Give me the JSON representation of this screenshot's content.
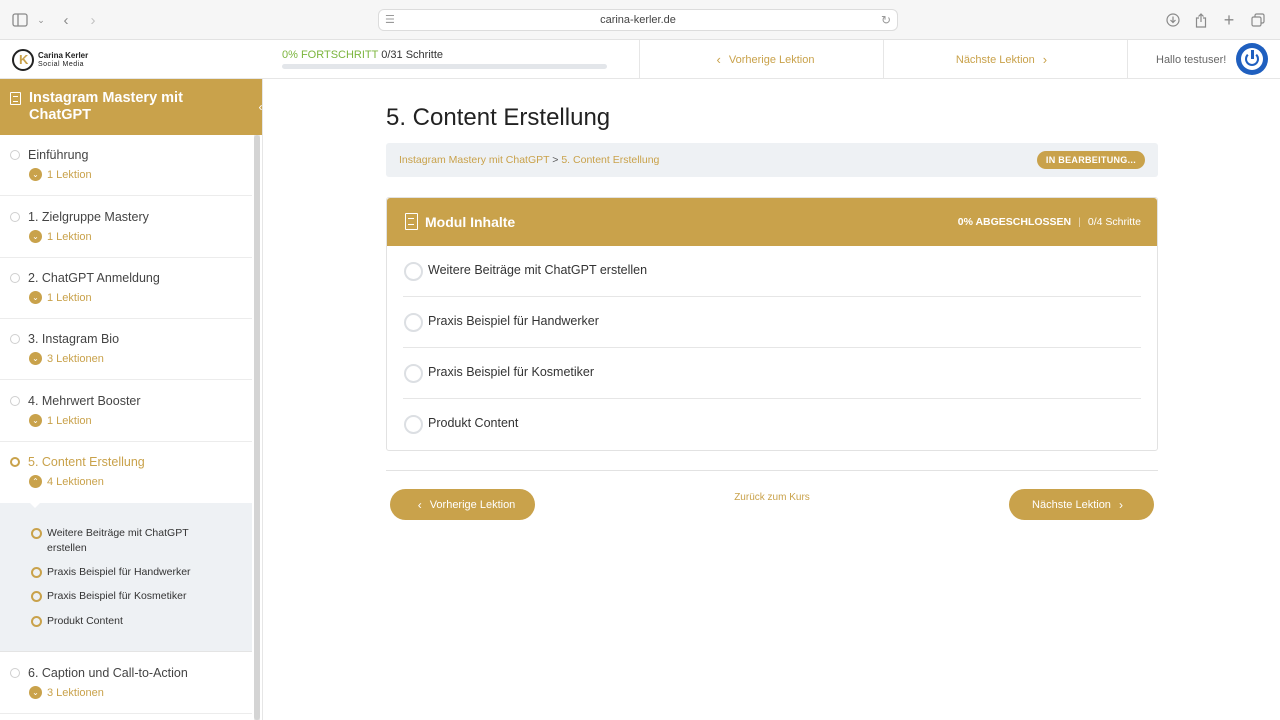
{
  "browser": {
    "url": "carina-kerler.de"
  },
  "header": {
    "logo_name": "Carina Kerler",
    "logo_sub": "Social Media",
    "progress_percent_label": "0% FORTSCHRITT",
    "progress_steps_label": "0/31 Schritte",
    "progress_fraction": 0.0,
    "prev_label": "Vorherige Lektion",
    "next_label": "Nächste Lektion",
    "greeting": "Hallo testuser!"
  },
  "sidebar": {
    "course_title": "Instagram Mastery mit ChatGPT",
    "sections": [
      {
        "title": "Einführung",
        "count": "1 Lektion"
      },
      {
        "title": "1. Zielgruppe Mastery",
        "count": "1 Lektion"
      },
      {
        "title": "2. ChatGPT Anmeldung",
        "count": "1 Lektion"
      },
      {
        "title": "3. Instagram Bio",
        "count": "3 Lektionen"
      },
      {
        "title": "4. Mehrwert Booster",
        "count": "1 Lektion"
      },
      {
        "title": "5. Content Erstellung",
        "count": "4 Lektionen"
      },
      {
        "title": "6. Caption und Call-to-Action",
        "count": "3 Lektionen"
      }
    ],
    "active_lessons": [
      "Weitere Beiträge mit ChatGPT erstellen",
      "Praxis Beispiel für Handwerker",
      "Praxis Beispiel für Kosmetiker",
      "Produkt Content"
    ]
  },
  "main": {
    "title": "5. Content Erstellung",
    "breadcrumb": {
      "course": "Instagram Mastery mit ChatGPT",
      "separator": ">",
      "current": "5. Content Erstellung"
    },
    "status_badge": "IN BEARBEITUNG...",
    "module": {
      "title": "Modul Inhalte",
      "completed_label": "0% ABGESCHLOSSEN",
      "steps_label": "0/4 Schritte",
      "lessons": [
        "Weitere Beiträge mit ChatGPT erstellen",
        "Praxis Beispiel für Handwerker",
        "Praxis Beispiel für Kosmetiker",
        "Produkt Content"
      ]
    },
    "prev_button": "Vorherige Lektion",
    "back_link": "Zurück zum Kurs",
    "next_button": "Nächste Lektion"
  },
  "colors": {
    "accent": "#c9a24b",
    "progress": "#7bb53d",
    "avatar": "#1f5fbf"
  }
}
